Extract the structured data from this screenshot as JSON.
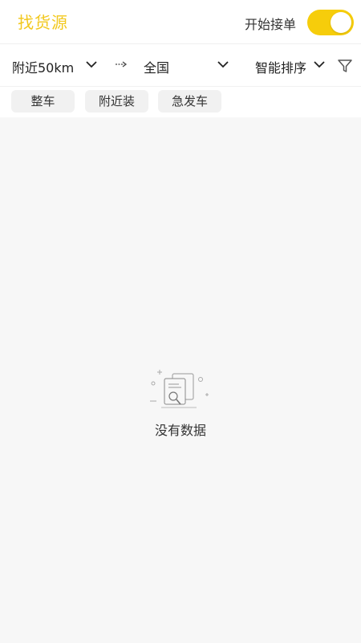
{
  "header": {
    "title": "找货源",
    "toggle_label": "开始接单",
    "toggle_on": true,
    "accent_color": "#f2c81d"
  },
  "filters": {
    "origin": "附近50km",
    "arrow_icon": "arrow-right-icon",
    "destination": "全国",
    "sort": "智能排序",
    "filter_icon": "funnel-icon"
  },
  "chips": [
    {
      "label": "整车"
    },
    {
      "label": "附近装"
    },
    {
      "label": "急发车"
    }
  ],
  "empty": {
    "icon": "empty-search-document-icon",
    "text": "没有数据"
  }
}
